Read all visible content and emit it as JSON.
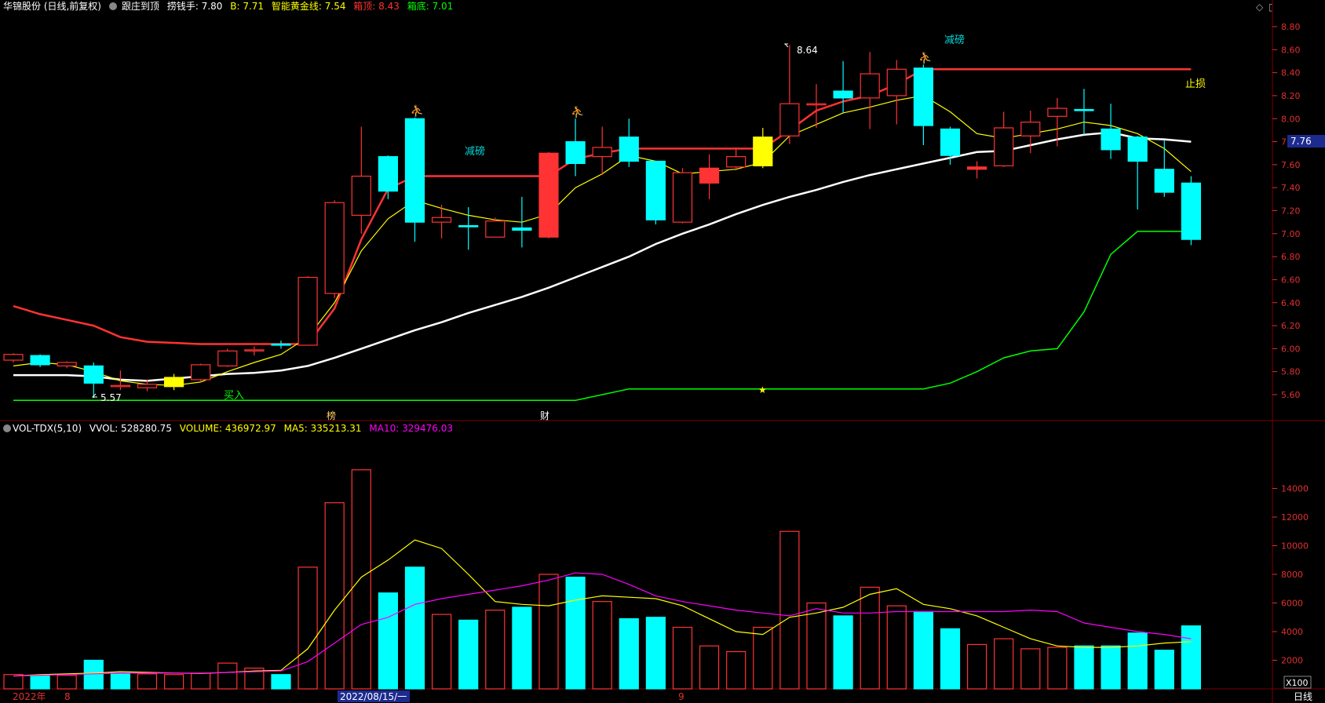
{
  "header": {
    "stock": "华锦股份 (日线,前复权)",
    "indicator": "跟庄到顶",
    "lqs": "捞钱手: 7.80",
    "b": "B: 7.71",
    "gold": "智能黄金线: 7.54",
    "top": "箱顶: 8.43",
    "bottom": "箱底: 7.01"
  },
  "vol_header": {
    "name": "VOL-TDX(5,10)",
    "vvol": "VVOL: 528280.75",
    "volume": "VOLUME: 436972.97",
    "ma5": "MA5: 335213.31",
    "ma10": "MA10: 329476.03"
  },
  "price_axis": [
    "8.80",
    "8.60",
    "8.40",
    "8.20",
    "8.00",
    "7.80",
    "7.60",
    "7.40",
    "7.20",
    "7.00",
    "6.80",
    "6.60",
    "6.40",
    "6.20",
    "6.00",
    "5.80",
    "5.60"
  ],
  "vol_axis": [
    "14000",
    "12000",
    "10000",
    "8000",
    "6000",
    "4000",
    "2000"
  ],
  "current_price": "7.76",
  "annotations": {
    "high": "8.64",
    "low": "5.57",
    "jianbang1": "减磅",
    "jianbang2": "减磅",
    "zhisun": "止损",
    "mairu": "买入",
    "bang": "榜",
    "cai": "财"
  },
  "date_axis": {
    "year": "2022年",
    "m8": "8",
    "selected": "2022/08/15/一",
    "m9": "9",
    "period": "日线",
    "scale": "X100"
  },
  "colors": {
    "up": "#ff3333",
    "down": "#00ffff",
    "white_ma": "#ffffff",
    "yellow_ma": "#ffff00",
    "green_line": "#00ff00",
    "magenta": "#ff00ff",
    "grid": "#7a0000"
  },
  "chart_data": {
    "type": "candlestick",
    "candles": [
      {
        "o": 5.9,
        "c": 5.95,
        "h": 5.96,
        "l": 5.88,
        "up": true
      },
      {
        "o": 5.94,
        "c": 5.86,
        "h": 5.95,
        "l": 5.84,
        "up": false
      },
      {
        "o": 5.85,
        "c": 5.88,
        "h": 5.89,
        "l": 5.83,
        "up": true
      },
      {
        "o": 5.85,
        "c": 5.7,
        "h": 5.88,
        "l": 5.57,
        "up": false
      },
      {
        "o": 5.67,
        "c": 5.68,
        "h": 5.81,
        "l": 5.64,
        "up": true
      },
      {
        "o": 5.66,
        "c": 5.69,
        "h": 5.73,
        "l": 5.63,
        "up": true
      },
      {
        "o": 5.67,
        "c": 5.75,
        "h": 5.78,
        "l": 5.64,
        "up": true,
        "yellow": true
      },
      {
        "o": 5.73,
        "c": 5.86,
        "h": 5.87,
        "l": 5.71,
        "up": true
      },
      {
        "o": 5.85,
        "c": 5.98,
        "h": 6.0,
        "l": 5.84,
        "up": true
      },
      {
        "o": 5.98,
        "c": 5.99,
        "h": 6.02,
        "l": 5.94,
        "up": true
      },
      {
        "o": 6.03,
        "c": 6.04,
        "h": 6.07,
        "l": 6.0,
        "up": false
      },
      {
        "o": 6.03,
        "c": 6.62,
        "h": 6.63,
        "l": 6.03,
        "up": true
      },
      {
        "o": 6.48,
        "c": 7.27,
        "h": 7.29,
        "l": 6.44,
        "up": true
      },
      {
        "o": 7.16,
        "c": 7.5,
        "h": 7.93,
        "l": 7.0,
        "up": true
      },
      {
        "o": 7.67,
        "c": 7.37,
        "h": 7.68,
        "l": 7.3,
        "up": false
      },
      {
        "o": 8.0,
        "c": 7.1,
        "h": 8.01,
        "l": 6.93,
        "up": false
      },
      {
        "o": 7.1,
        "c": 7.14,
        "h": 7.25,
        "l": 6.96,
        "up": true
      },
      {
        "o": 7.07,
        "c": 7.06,
        "h": 7.23,
        "l": 6.86,
        "up": false
      },
      {
        "o": 6.97,
        "c": 7.11,
        "h": 7.14,
        "l": 6.97,
        "up": true
      },
      {
        "o": 7.05,
        "c": 7.03,
        "h": 7.32,
        "l": 6.88,
        "up": false
      },
      {
        "o": 6.97,
        "c": 7.7,
        "h": 7.71,
        "l": 6.96,
        "up": true,
        "solid": true
      },
      {
        "o": 7.8,
        "c": 7.61,
        "h": 8.0,
        "l": 7.5,
        "up": false
      },
      {
        "o": 7.67,
        "c": 7.75,
        "h": 7.93,
        "l": 7.51,
        "up": true
      },
      {
        "o": 7.84,
        "c": 7.63,
        "h": 8.0,
        "l": 7.58,
        "up": false
      },
      {
        "o": 7.63,
        "c": 7.12,
        "h": 7.63,
        "l": 7.08,
        "up": false
      },
      {
        "o": 7.1,
        "c": 7.53,
        "h": 7.57,
        "l": 7.09,
        "up": true
      },
      {
        "o": 7.44,
        "c": 7.57,
        "h": 7.69,
        "l": 7.3,
        "up": true,
        "solid": true
      },
      {
        "o": 7.58,
        "c": 7.67,
        "h": 7.75,
        "l": 7.55,
        "up": true
      },
      {
        "o": 7.59,
        "c": 7.84,
        "h": 7.92,
        "l": 7.57,
        "up": true,
        "yellow": true
      },
      {
        "o": 7.85,
        "c": 8.13,
        "h": 8.64,
        "l": 7.78,
        "up": true
      },
      {
        "o": 8.12,
        "c": 8.13,
        "h": 8.3,
        "l": 7.92,
        "up": true
      },
      {
        "o": 8.24,
        "c": 8.18,
        "h": 8.5,
        "l": 8.05,
        "up": false
      },
      {
        "o": 8.18,
        "c": 8.39,
        "h": 8.58,
        "l": 7.91,
        "up": true
      },
      {
        "o": 8.2,
        "c": 8.43,
        "h": 8.51,
        "l": 7.95,
        "up": true
      },
      {
        "o": 8.44,
        "c": 7.94,
        "h": 8.47,
        "l": 7.77,
        "up": false
      },
      {
        "o": 7.91,
        "c": 7.68,
        "h": 7.93,
        "l": 7.6,
        "up": false
      },
      {
        "o": 7.58,
        "c": 7.56,
        "h": 7.63,
        "l": 7.48,
        "up": true,
        "solid": true
      },
      {
        "o": 7.59,
        "c": 7.92,
        "h": 8.06,
        "l": 7.58,
        "up": true
      },
      {
        "o": 7.85,
        "c": 7.97,
        "h": 8.07,
        "l": 7.7,
        "up": true
      },
      {
        "o": 8.02,
        "c": 8.09,
        "h": 8.18,
        "l": 7.76,
        "up": true
      },
      {
        "o": 8.08,
        "c": 8.07,
        "h": 8.26,
        "l": 7.86,
        "up": false
      },
      {
        "o": 7.91,
        "c": 7.73,
        "h": 8.13,
        "l": 7.65,
        "up": false
      },
      {
        "o": 7.84,
        "c": 7.63,
        "h": 7.85,
        "l": 7.21,
        "up": false,
        "solid": true
      },
      {
        "o": 7.56,
        "c": 7.36,
        "h": 7.81,
        "l": 7.32,
        "up": false,
        "solid": true
      },
      {
        "o": 7.44,
        "c": 6.95,
        "h": 7.5,
        "l": 6.9,
        "up": false,
        "solid": true
      }
    ],
    "volume": [
      {
        "v": 1000,
        "up": true
      },
      {
        "v": 900,
        "up": false
      },
      {
        "v": 950,
        "up": true
      },
      {
        "v": 2000,
        "up": false
      },
      {
        "v": 1100,
        "up": false
      },
      {
        "v": 1050,
        "up": true
      },
      {
        "v": 1000,
        "up": true
      },
      {
        "v": 1100,
        "up": true
      },
      {
        "v": 1800,
        "up": true
      },
      {
        "v": 1450,
        "up": true
      },
      {
        "v": 1000,
        "up": false
      },
      {
        "v": 8500,
        "up": true
      },
      {
        "v": 13000,
        "up": true
      },
      {
        "v": 15300,
        "up": true
      },
      {
        "v": 6700,
        "up": false
      },
      {
        "v": 8500,
        "up": false
      },
      {
        "v": 5200,
        "up": true
      },
      {
        "v": 4800,
        "up": false
      },
      {
        "v": 5500,
        "up": true
      },
      {
        "v": 5700,
        "up": false
      },
      {
        "v": 8000,
        "up": true
      },
      {
        "v": 7800,
        "up": false
      },
      {
        "v": 6100,
        "up": true
      },
      {
        "v": 4900,
        "up": false
      },
      {
        "v": 5000,
        "up": false
      },
      {
        "v": 4300,
        "up": true
      },
      {
        "v": 3000,
        "up": true
      },
      {
        "v": 2600,
        "up": true
      },
      {
        "v": 4300,
        "up": true
      },
      {
        "v": 11000,
        "up": true
      },
      {
        "v": 6000,
        "up": true
      },
      {
        "v": 5100,
        "up": false
      },
      {
        "v": 7100,
        "up": true
      },
      {
        "v": 5800,
        "up": true
      },
      {
        "v": 5400,
        "up": false
      },
      {
        "v": 4200,
        "up": false
      },
      {
        "v": 3100,
        "up": true
      },
      {
        "v": 3500,
        "up": true
      },
      {
        "v": 2800,
        "up": true
      },
      {
        "v": 2900,
        "up": true
      },
      {
        "v": 3000,
        "up": false
      },
      {
        "v": 3000,
        "up": false
      },
      {
        "v": 3900,
        "up": false
      },
      {
        "v": 2700,
        "up": false
      },
      {
        "v": 4400,
        "up": false
      }
    ],
    "ma_white": [
      5.77,
      5.77,
      5.77,
      5.76,
      5.73,
      5.72,
      5.74,
      5.76,
      5.78,
      5.79,
      5.81,
      5.85,
      5.92,
      6.0,
      6.08,
      6.16,
      6.23,
      6.31,
      6.38,
      6.45,
      6.53,
      6.62,
      6.71,
      6.8,
      6.91,
      7.0,
      7.08,
      7.17,
      7.25,
      7.32,
      7.38,
      7.45,
      7.51,
      7.56,
      7.61,
      7.66,
      7.71,
      7.72,
      7.77,
      7.82,
      7.86,
      7.88,
      7.83,
      7.82,
      7.8
    ],
    "ma_yellow": [
      5.85,
      5.88,
      5.86,
      5.8,
      5.72,
      5.69,
      5.68,
      5.71,
      5.8,
      5.88,
      5.95,
      6.1,
      6.4,
      6.85,
      7.13,
      7.29,
      7.22,
      7.16,
      7.12,
      7.1,
      7.17,
      7.4,
      7.52,
      7.68,
      7.63,
      7.52,
      7.54,
      7.56,
      7.62,
      7.85,
      7.95,
      8.05,
      8.1,
      8.16,
      8.2,
      8.06,
      7.87,
      7.83,
      7.87,
      7.91,
      7.97,
      7.94,
      7.87,
      7.74,
      7.54
    ],
    "red_line": [
      6.37,
      6.3,
      6.25,
      6.2,
      6.1,
      6.06,
      6.05,
      6.04,
      6.04,
      6.04,
      6.04,
      6.04,
      6.35,
      6.95,
      7.39,
      7.5,
      7.5,
      7.5,
      7.5,
      7.5,
      7.5,
      7.65,
      7.7,
      7.74,
      7.74,
      7.74,
      7.74,
      7.74,
      7.74,
      7.9,
      8.07,
      8.15,
      8.2,
      8.3,
      8.43,
      8.43,
      8.43,
      8.43,
      8.43,
      8.43,
      8.43,
      8.43,
      8.43,
      8.43,
      8.43
    ],
    "green_line": [
      5.55,
      5.55,
      5.55,
      5.55,
      5.55,
      5.55,
      5.55,
      5.55,
      5.55,
      5.55,
      5.55,
      5.55,
      5.55,
      5.55,
      5.55,
      5.55,
      5.55,
      5.55,
      5.55,
      5.55,
      5.55,
      5.55,
      5.6,
      5.65,
      5.65,
      5.65,
      5.65,
      5.65,
      5.65,
      5.65,
      5.65,
      5.65,
      5.65,
      5.65,
      5.65,
      5.7,
      5.8,
      5.92,
      5.98,
      6.0,
      6.32,
      6.82,
      7.02,
      7.02,
      7.02
    ],
    "vol_ma5": [
      900,
      1000,
      1050,
      1100,
      1200,
      1150,
      1100,
      1080,
      1150,
      1250,
      1300,
      2800,
      5500,
      7800,
      9000,
      10400,
      9800,
      8000,
      6100,
      5900,
      5800,
      6200,
      6500,
      6400,
      6300,
      5800,
      4900,
      4000,
      3800,
      5000,
      5300,
      5700,
      6600,
      7000,
      5900,
      5600,
      5100,
      4300,
      3500,
      3000,
      2900,
      2900,
      3000,
      3200,
      3300
    ],
    "vol_ma10": [
      900,
      950,
      1000,
      1050,
      1100,
      1100,
      1100,
      1100,
      1150,
      1200,
      1250,
      1900,
      3200,
      4500,
      5000,
      5900,
      6300,
      6600,
      6900,
      7200,
      7600,
      8100,
      8000,
      7300,
      6500,
      6100,
      5800,
      5500,
      5300,
      5100,
      5600,
      5300,
      5300,
      5400,
      5400,
      5400,
      5400,
      5400,
      5500,
      5400,
      4600,
      4300,
      4000,
      3800,
      3500
    ]
  }
}
